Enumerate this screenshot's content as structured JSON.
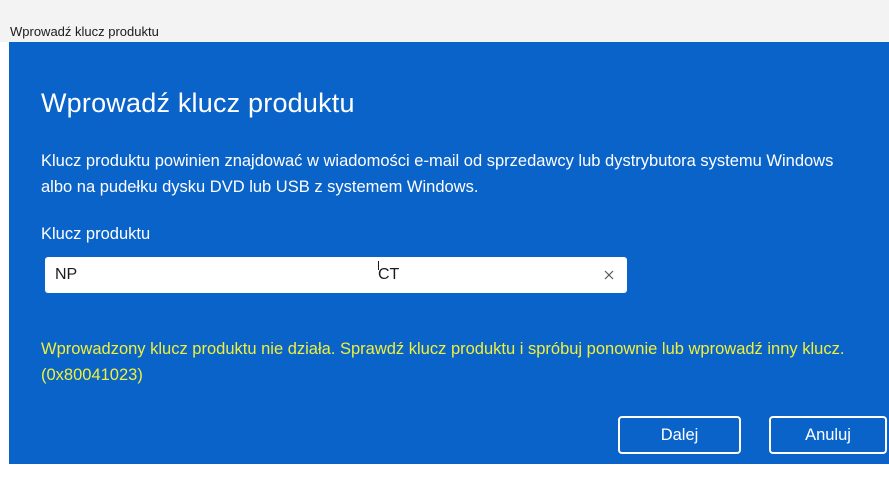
{
  "window": {
    "title": "Wprowadź klucz produktu"
  },
  "dialog": {
    "heading": "Wprowadź klucz produktu",
    "description": "Klucz produktu powinien znajdować w wiadomości e-mail od sprzedawcy lub dystrybutora systemu Windows albo na pudełku dysku DVD lub USB z systemem Windows.",
    "field_label": "Klucz produktu",
    "key_value_start": "NP",
    "key_value_end": "CT",
    "error_message": "Wprowadzony klucz produktu nie działa. Sprawdź klucz produktu i spróbuj ponownie lub wprowadź inny klucz. (0x80041023)",
    "colors": {
      "background": "#0a63c9",
      "error_text": "#f0f03c",
      "text": "#ffffff"
    }
  },
  "buttons": {
    "next_label": "Dalej",
    "cancel_label": "Anuluj"
  },
  "icons": {
    "clear": "close-icon"
  }
}
